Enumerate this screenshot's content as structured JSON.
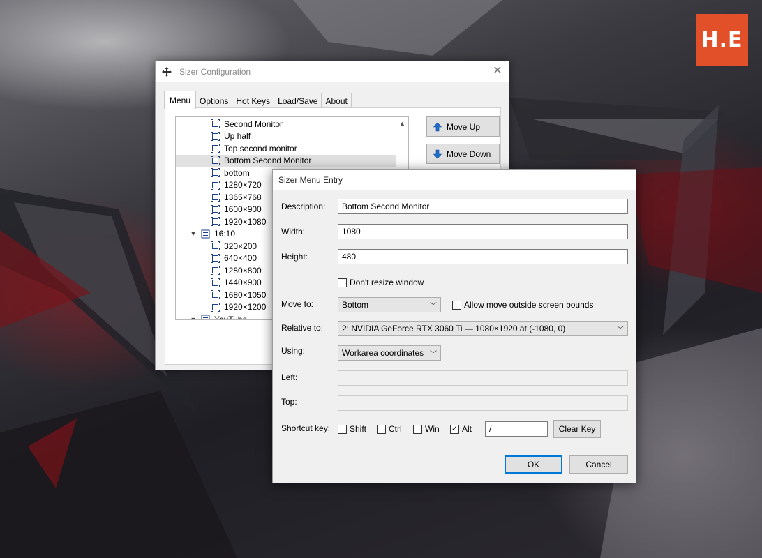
{
  "logo": {
    "text": "H.E"
  },
  "config_window": {
    "title": "Sizer Configuration",
    "tabs": [
      {
        "label": "Menu",
        "active": true
      },
      {
        "label": "Options",
        "active": false
      },
      {
        "label": "Hot Keys",
        "active": false
      },
      {
        "label": "Load/Save",
        "active": false
      },
      {
        "label": "About",
        "active": false
      }
    ],
    "tree_items": [
      {
        "label": "Second Monitor",
        "type": "item",
        "selected": false
      },
      {
        "label": "Up half",
        "type": "item",
        "selected": false
      },
      {
        "label": "Top second monitor",
        "type": "item",
        "selected": false
      },
      {
        "label": "Bottom Second Monitor",
        "type": "item",
        "selected": true
      },
      {
        "label": "bottom",
        "type": "item",
        "selected": false
      },
      {
        "label": "1280×720",
        "type": "item",
        "selected": false
      },
      {
        "label": "1365×768",
        "type": "item",
        "selected": false
      },
      {
        "label": "1600×900",
        "type": "item",
        "selected": false
      },
      {
        "label": "1920×1080",
        "type": "item",
        "selected": false
      },
      {
        "label": "16:10",
        "type": "group",
        "selected": false
      },
      {
        "label": "320×200",
        "type": "item",
        "selected": false
      },
      {
        "label": "640×400",
        "type": "item",
        "selected": false
      },
      {
        "label": "1280×800",
        "type": "item",
        "selected": false
      },
      {
        "label": "1440×900",
        "type": "item",
        "selected": false
      },
      {
        "label": "1680×1050",
        "type": "item",
        "selected": false
      },
      {
        "label": "1920×1200",
        "type": "item",
        "selected": false
      },
      {
        "label": "YouTube",
        "type": "group",
        "selected": false
      }
    ],
    "move_up_label": "Move Up",
    "move_down_label": "Move Down"
  },
  "entry_dialog": {
    "title": "Sizer Menu Entry",
    "description_label": "Description:",
    "description_value": "Bottom Second Monitor",
    "width_label": "Width:",
    "width_value": "1080",
    "height_label": "Height:",
    "height_value": "480",
    "dont_resize_label": "Don't resize window",
    "dont_resize_checked": false,
    "move_to_label": "Move to:",
    "move_to_value": "Bottom",
    "allow_outside_label": "Allow move outside screen bounds",
    "allow_outside_checked": false,
    "relative_to_label": "Relative to:",
    "relative_to_value": "2: NVIDIA GeForce RTX 3060 Ti — 1080×1920 at (-1080, 0)",
    "using_label": "Using:",
    "using_value": "Workarea coordinates",
    "left_label": "Left:",
    "left_value": "",
    "top_label": "Top:",
    "top_value": "",
    "shortcut_label": "Shortcut key:",
    "shift_label": "Shift",
    "shift_checked": false,
    "ctrl_label": "Ctrl",
    "ctrl_checked": false,
    "win_label": "Win",
    "win_checked": false,
    "alt_label": "Alt",
    "alt_checked": true,
    "key_value": "/",
    "clear_key_label": "Clear Key",
    "ok_label": "OK",
    "cancel_label": "Cancel"
  }
}
